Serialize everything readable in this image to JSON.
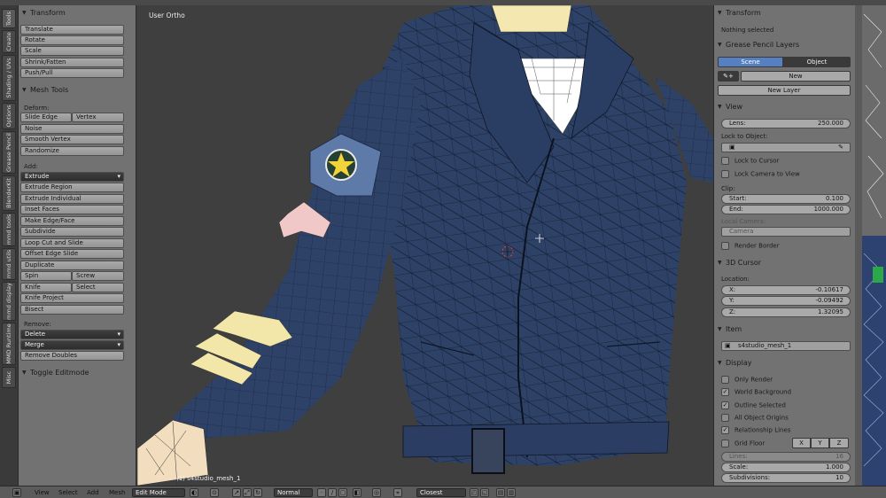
{
  "viewport": {
    "title": "User Ortho",
    "object_label": "(1) s4studio_mesh_1"
  },
  "left_tabs": [
    "Tools",
    "Create",
    "Shading / UVs",
    "Options",
    "Grease Pencil",
    "BlenderKit",
    "mmd tools",
    "mmd utils",
    "mmd display",
    "MMD Runtime",
    "Misc"
  ],
  "tool_shelf": {
    "transform": {
      "title": "Transform",
      "buttons": [
        "Translate",
        "Rotate",
        "Scale",
        "Shrink/Fatten",
        "Push/Pull"
      ]
    },
    "mesh_tools": {
      "title": "Mesh Tools",
      "deform_label": "Deform:",
      "slide_edge": "Slide Edge",
      "vertex": "Vertex",
      "noise": "Noise",
      "smooth_vertex": "Smooth Vertex",
      "randomize": "Randomize",
      "add_label": "Add:",
      "extrude": "Extrude",
      "add_buttons": [
        "Extrude Region",
        "Extrude Individual",
        "Inset Faces",
        "Make Edge/Face",
        "Subdivide",
        "Loop Cut and Slide",
        "Offset Edge Slide",
        "Duplicate"
      ],
      "spin": "Spin",
      "screw": "Screw",
      "knife": "Knife",
      "select": "Select",
      "knife_project": "Knife Project",
      "bisect": "Bisect",
      "remove_label": "Remove:",
      "delete": "Delete",
      "merge": "Merge",
      "remove_doubles": "Remove Doubles"
    },
    "toggle_editmode": "Toggle Editmode"
  },
  "properties": {
    "transform": {
      "title": "Transform",
      "status": "Nothing selected"
    },
    "grease_pencil": {
      "title": "Grease Pencil Layers",
      "tab_scene": "Scene",
      "tab_object": "Object",
      "new": "New",
      "new_layer": "New Layer"
    },
    "view": {
      "title": "View",
      "lens_label": "Lens:",
      "lens_value": "250.000",
      "lock_to_object": "Lock to Object:",
      "lock_to_cursor": "Lock to Cursor",
      "lock_camera_to_view": "Lock Camera to View",
      "clip_label": "Clip:",
      "clip_start_label": "Start:",
      "clip_start": "0.100",
      "clip_end_label": "End:",
      "clip_end": "1000.000",
      "local_camera": "Local Camera:",
      "camera": "Camera",
      "render_border": "Render Border"
    },
    "cursor": {
      "title": "3D Cursor",
      "location": "Location:",
      "x_label": "X:",
      "x": "-0.10617",
      "y_label": "Y:",
      "y": "-0.09492",
      "z_label": "Z:",
      "z": "1.32095"
    },
    "item": {
      "title": "Item",
      "name": "s4studio_mesh_1"
    },
    "display": {
      "title": "Display",
      "only_render": "Only Render",
      "world_background": "World Background",
      "outline_selected": "Outline Selected",
      "all_object_origins": "All Object Origins",
      "relationship_lines": "Relationship Lines",
      "grid_floor": "Grid Floor",
      "grid_x": "X",
      "grid_y": "Y",
      "grid_z": "Z",
      "lines_label": "Lines:",
      "lines": "16",
      "scale_label": "Scale:",
      "scale": "1.000",
      "subdivisions_label": "Subdivisions:",
      "subdivisions": "10"
    }
  },
  "bottom_bar": {
    "view": "View",
    "select": "Select",
    "add": "Add",
    "mesh": "Mesh",
    "mode": "Edit Mode",
    "pivot": "Normal",
    "snap": "Closest"
  },
  "colors": {
    "jacket": "#2e4268",
    "shirt": "#ffffff",
    "stripe": "#f2e6a8",
    "chevron_pink": "#f0c8c8",
    "scene_tab": "#5680c2"
  }
}
